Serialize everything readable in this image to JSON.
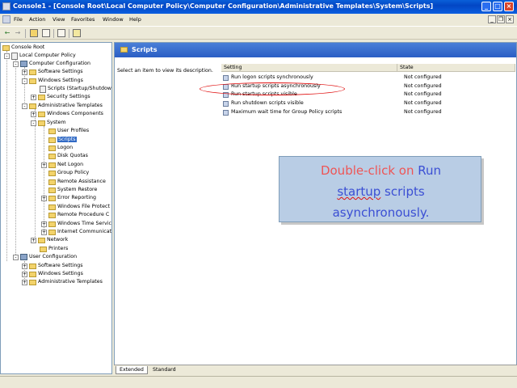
{
  "window": {
    "title": "Console1 - [Console Root\\Local Computer Policy\\Computer Configuration\\Administrative Templates\\System\\Scripts]",
    "minimize": "_",
    "maximize": "□",
    "close": "×"
  },
  "menu": {
    "items": [
      "File",
      "Action",
      "View",
      "Favorites",
      "Window",
      "Help"
    ],
    "mdi_minimize": "_",
    "mdi_restore": "❐",
    "mdi_close": "×"
  },
  "toolbar": {
    "back": "←",
    "forward": "→"
  },
  "tree": {
    "nodes": [
      {
        "label": "Console Root"
      },
      {
        "label": "Local Computer Policy",
        "exp": "-"
      },
      {
        "label": "Computer Configuration",
        "exp": "-"
      },
      {
        "label": "Software Settings",
        "exp": "+"
      },
      {
        "label": "Windows Settings",
        "exp": "-"
      },
      {
        "label": "Scripts (Startup/Shutdow"
      },
      {
        "label": "Security Settings",
        "exp": "+"
      },
      {
        "label": "Administrative Templates",
        "exp": "-"
      },
      {
        "label": "Windows Components",
        "exp": "+"
      },
      {
        "label": "System",
        "exp": "-"
      },
      {
        "label": "User Profiles"
      },
      {
        "label": "Scripts"
      },
      {
        "label": "Logon"
      },
      {
        "label": "Disk Quotas"
      },
      {
        "label": "Net Logon",
        "exp": "+"
      },
      {
        "label": "Group Policy"
      },
      {
        "label": "Remote Assistance"
      },
      {
        "label": "System Restore"
      },
      {
        "label": "Error Reporting",
        "exp": "+"
      },
      {
        "label": "Windows File Protect"
      },
      {
        "label": "Remote Procedure C"
      },
      {
        "label": "Windows Time Servic",
        "exp": "+"
      },
      {
        "label": "Internet Communicat",
        "exp": "+"
      },
      {
        "label": "Network",
        "exp": "+"
      },
      {
        "label": "Printers"
      },
      {
        "label": "User Configuration",
        "exp": "-"
      },
      {
        "label": "Software Settings",
        "exp": "+"
      },
      {
        "label": "Windows Settings",
        "exp": "+"
      },
      {
        "label": "Administrative Templates",
        "exp": "+"
      }
    ]
  },
  "details": {
    "header_title": "Scripts",
    "hint": "Select an item to view its description.",
    "col_setting": "Setting",
    "col_state": "State",
    "rows": [
      {
        "name": "Run logon scripts synchronously",
        "state": "Not configured"
      },
      {
        "name": "Run startup scripts asynchronously",
        "state": "Not configured"
      },
      {
        "name": "Run startup scripts visible",
        "state": "Not configured"
      },
      {
        "name": "Run shutdown scripts visible",
        "state": "Not configured"
      },
      {
        "name": "Maximum wait time for Group Policy scripts",
        "state": "Not configured"
      }
    ]
  },
  "callout": {
    "line1_a": "Double-click on ",
    "line1_b": "Run",
    "line2_a": "startup",
    "line2_b": " scripts",
    "line3": "asynchronously."
  },
  "tabs": [
    "Extended",
    "Standard"
  ],
  "colors": {
    "callout_bg": "#b9cde5",
    "highlight_red": "#e01010",
    "titlebar_blue": "#0246c4"
  }
}
